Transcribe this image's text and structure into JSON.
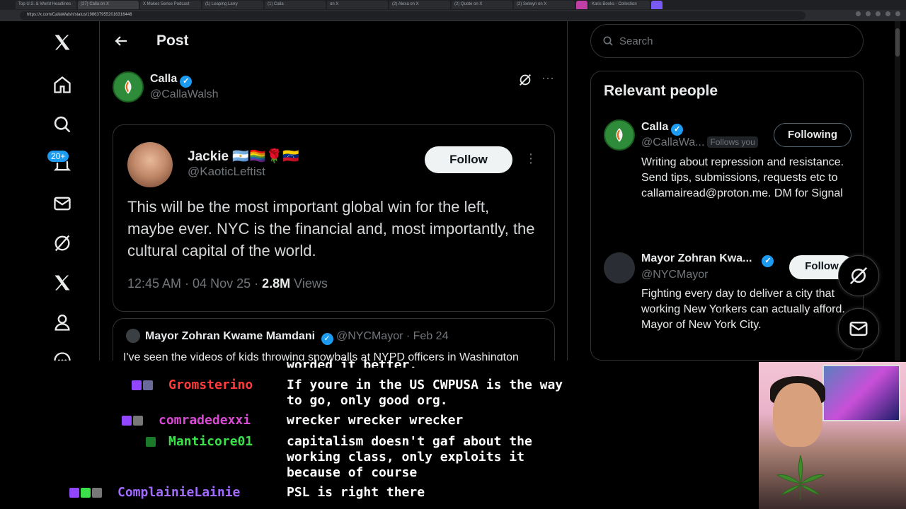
{
  "browser": {
    "tabs": [
      "Top U.S. & World Headlines",
      "(27) Calla on X",
      "X Makes Sense Podcast",
      "(1) Leaping Larry",
      "(1) Calla",
      "on X",
      "(2) Alexa on X",
      "(2) Quote on X",
      "(2) Selwyn on X",
      "",
      "Karis Books - Collection",
      ""
    ],
    "url": "https://x.com/CallaWalsh/status/1986379552016316448"
  },
  "colors": {
    "accent": "#1d9bf0",
    "chat_red": "#ff3b3b",
    "chat_magenta": "#d94ad4",
    "chat_green": "#3be04b",
    "chat_purple": "#a26bff"
  },
  "nav": {
    "icons": [
      "x-logo-icon",
      "home-icon",
      "search-icon",
      "notifications-icon",
      "messages-icon",
      "grok-icon",
      "premium-x-icon",
      "profile-icon",
      "more-icon"
    ],
    "notif_badge": "20+"
  },
  "header": {
    "title": "Post"
  },
  "post": {
    "author_name": "Calla",
    "author_handle": "@CallaWalsh"
  },
  "quote": {
    "name": "Jackie 🇦🇷🏳️‍🌈🌹🇻🇪",
    "handle": "@KaoticLeftist",
    "follow_label": "Follow",
    "text": "This will be the most important global win for the left, maybe ever. NYC is the financial and, most importantly, the cultural capital of the world.",
    "time": "12:45 AM · 04 Nov 25 · ",
    "views_count": "2.8M",
    "views_label": " Views"
  },
  "reply": {
    "name": "Mayor Zohran Kwame Mamdani",
    "handle": "@NYCMayor",
    "date": " · Feb 24",
    "text": "I've seen the videos of kids throwing snowballs at NYPD officers in Washington"
  },
  "search": {
    "placeholder": "Search"
  },
  "people": {
    "title": "Relevant people",
    "items": [
      {
        "name": "Calla",
        "handle": "@CallaWa...",
        "follows_you": "Follows you",
        "button": "Following",
        "bio": "Writing about repression and resistance. Send tips, submissions, requests etc to callamairead@proton.me. DM for Signal"
      },
      {
        "name": "Mayor Zohran Kwa...",
        "handle": "@NYCMayor",
        "button": "Follow",
        "bio": "Fighting every day to deliver a city that working New Yorkers can actually afford. Mayor of New York City."
      }
    ]
  },
  "chat": {
    "top_partial": "worded it better.",
    "messages": [
      {
        "user": "Gromsterino",
        "color": "#ff3b3b",
        "text": "If youre in the US CWPUSA is the way\nto go, only good org."
      },
      {
        "user": "comradedexxi",
        "color": "#d94ad4",
        "text": "wrecker wrecker wrecker"
      },
      {
        "user": "Manticore01",
        "color": "#3be04b",
        "text": "capitalism doesn't gaf about the\nworking class, only exploits it\nbecause of course"
      },
      {
        "user": "ComplainieLainie",
        "color": "#a26bff",
        "text": "PSL is right there"
      }
    ]
  }
}
